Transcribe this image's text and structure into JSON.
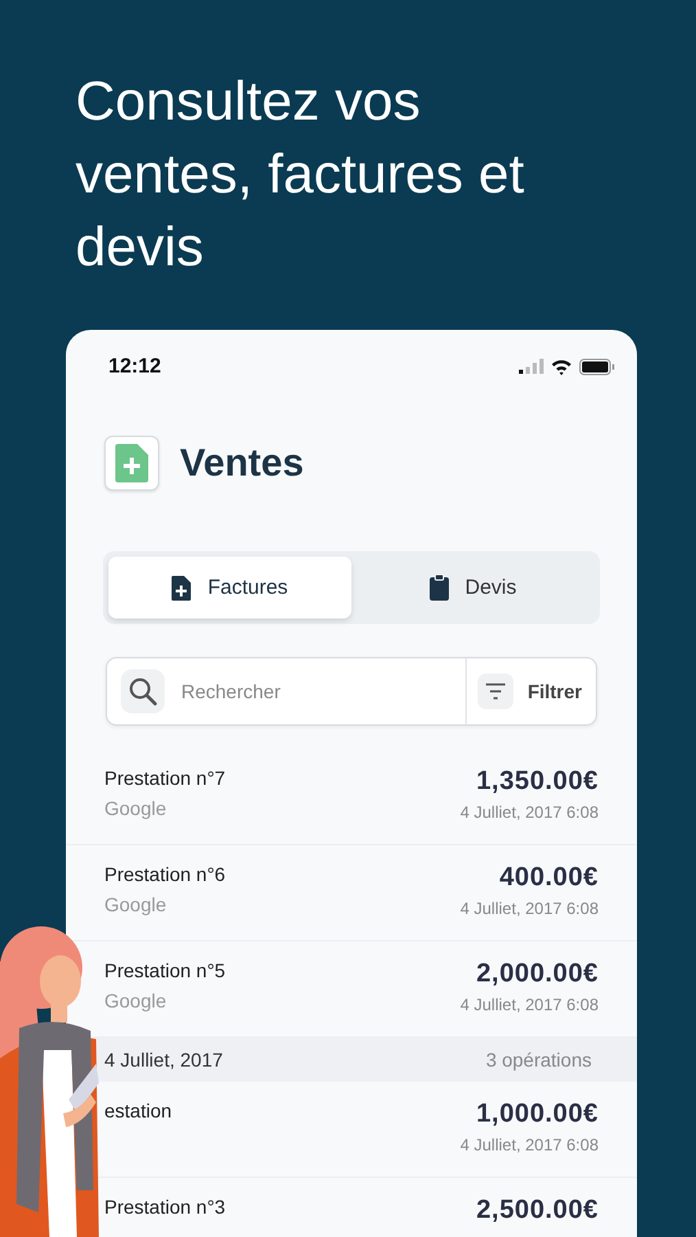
{
  "headline": "Consultez vos ventes, factures et devis",
  "status_bar": {
    "time": "12:12"
  },
  "header": {
    "title": "Ventes"
  },
  "tabs": [
    {
      "label": "Factures",
      "kind": "invoice",
      "selected": true
    },
    {
      "label": "Devis",
      "kind": "clipboard",
      "selected": false
    }
  ],
  "search": {
    "placeholder": "Rechercher",
    "filter_label": "Filtrer"
  },
  "list": [
    {
      "kind": "item",
      "title": "Prestation n°7",
      "client": "Google",
      "amount": "1,350.00€",
      "date": "4 Julliet, 2017 6:08"
    },
    {
      "kind": "item",
      "title": "Prestation n°6",
      "client": "Google",
      "amount": "400.00€",
      "date": "4 Julliet, 2017 6:08"
    },
    {
      "kind": "item",
      "title": "Prestation n°5",
      "client": "Google",
      "amount": "2,000.00€",
      "date": "4 Julliet, 2017 6:08"
    },
    {
      "kind": "section",
      "title": "4 Julliet, 2017",
      "count": "3 opérations"
    },
    {
      "kind": "item",
      "title": "estation",
      "amount": "1,000.00€",
      "date": "4 Julliet, 2017 6:08"
    },
    {
      "kind": "item",
      "title": "Prestation n°3",
      "amount": "2,500.00€"
    }
  ]
}
